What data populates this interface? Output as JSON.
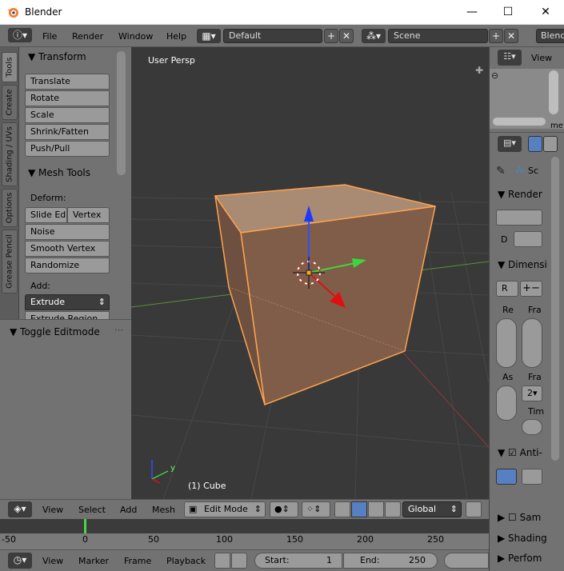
{
  "window": {
    "title": "Blender",
    "minimize": "—",
    "maximize": "☐",
    "close": "✕"
  },
  "menubar": {
    "items": [
      "File",
      "Render",
      "Window",
      "Help"
    ],
    "layout_value": "Default",
    "scene_value": "Scene",
    "engine_partial": "Blend"
  },
  "tool_tabs": [
    "Tools",
    "Create",
    "Shading / UVs",
    "Options",
    "Grease Pencil"
  ],
  "tools": {
    "transform_header": "Transform",
    "transform_buttons": [
      "Translate",
      "Rotate",
      "Scale",
      "Shrink/Fatten",
      "Push/Pull"
    ],
    "mesh_tools_header": "Mesh Tools",
    "deform_label": "Deform:",
    "slide_edge": "Slide Ed",
    "vertex": "Vertex",
    "deform_buttons": [
      "Noise",
      "Smooth Vertex",
      "Randomize"
    ],
    "add_label": "Add:",
    "extrude_value": "Extrude",
    "extrude_region": "Extrude Region",
    "toggle_editmode": "Toggle Editmode"
  },
  "viewport": {
    "view_label": "User Persp",
    "object_label": "(1) Cube",
    "axis_y": "y"
  },
  "outliner": {
    "view_label": "View",
    "partial_text": "me"
  },
  "properties": {
    "scene_partial": "Sc",
    "render_header": "Render",
    "d_label": "D",
    "dimensions_header": "Dimensi",
    "preset_label": "R",
    "col_re": "Re",
    "col_fra": "Fra",
    "col_as": "As",
    "col_fra2": "Fra",
    "frame_value": "2",
    "col_tim": "Tim",
    "anti_label": "Anti-",
    "sampling_label": "Sam",
    "shading_label": "Shading",
    "performance_label": "Perfom"
  },
  "view_header": {
    "menus": [
      "View",
      "Select",
      "Add",
      "Mesh"
    ],
    "mode_value": "Edit Mode",
    "orientation_value": "Global"
  },
  "timeline": {
    "ticks": [
      "-50",
      "0",
      "50",
      "100",
      "150",
      "200",
      "250"
    ],
    "current_frame": 0
  },
  "timeline_header": {
    "menus": [
      "View",
      "Marker",
      "Frame",
      "Playback"
    ],
    "start_label": "Start:",
    "start_value": "1",
    "end_label": "End:",
    "end_value": "250"
  },
  "colors": {
    "accent": "#f5a623",
    "selected": "#ffa34d",
    "viewport_bg": "#393939",
    "panel_bg": "#727272"
  }
}
